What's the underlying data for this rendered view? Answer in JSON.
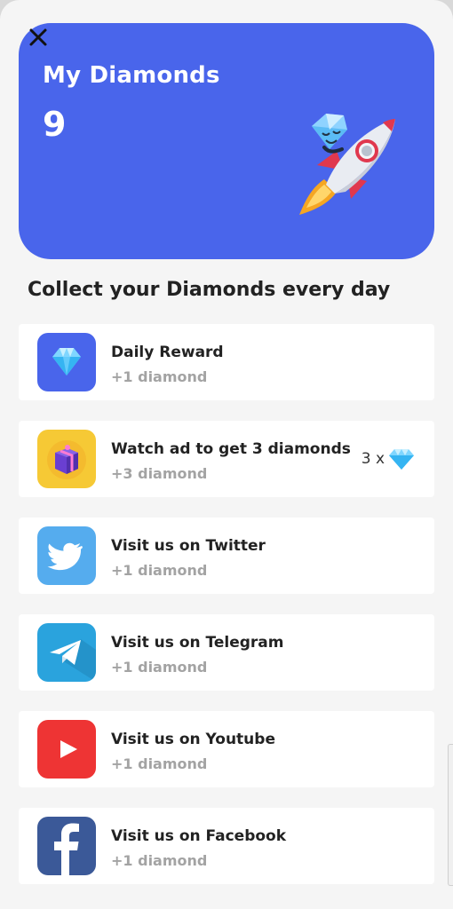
{
  "header": {
    "close_icon": "close-icon",
    "title": "My Diamonds",
    "count": "9",
    "illustration": "rocket-with-diamond-icon",
    "accent_color": "#4965eb"
  },
  "section": {
    "title": "Collect your Diamonds every day"
  },
  "rewards": [
    {
      "title": "Daily Reward",
      "subtitle": "+1 diamond",
      "icon": "diamond-icon",
      "color": "#4965eb"
    },
    {
      "title": "Watch ad to get 3 diamonds",
      "subtitle": "+3 diamond",
      "icon": "gift-box-icon",
      "color": "#f6c935",
      "multiplier": "3 x"
    },
    {
      "title": "Visit us on Twitter",
      "subtitle": "+1 diamond",
      "icon": "twitter-icon",
      "color": "#55acee"
    },
    {
      "title": "Visit us on Telegram",
      "subtitle": "+1 diamond",
      "icon": "telegram-icon",
      "color": "#2aa3dd"
    },
    {
      "title": "Visit us on Youtube",
      "subtitle": "+1 diamond",
      "icon": "youtube-icon",
      "color": "#ee3434"
    },
    {
      "title": "Visit us on Facebook",
      "subtitle": "+1 diamond",
      "icon": "facebook-icon",
      "color": "#3b5998"
    }
  ]
}
